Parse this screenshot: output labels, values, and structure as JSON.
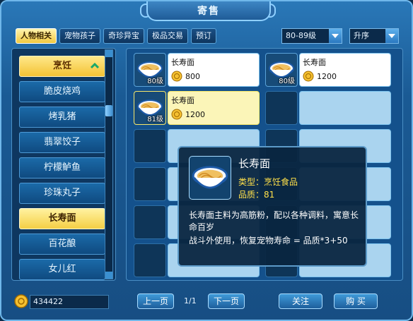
{
  "window": {
    "title": "寄售"
  },
  "tabs": [
    {
      "label": "人物相关",
      "active": true
    },
    {
      "label": "宠物孩子",
      "active": false
    },
    {
      "label": "奇珍异宝",
      "active": false
    },
    {
      "label": "极品交易",
      "active": false
    },
    {
      "label": "预订",
      "active": false
    }
  ],
  "filters": {
    "level": "80-89级",
    "sort": "升序"
  },
  "categories": {
    "header": "烹饪",
    "items": [
      "脆皮烧鸡",
      "烤乳猪",
      "翡翠饺子",
      "柠檬鲈鱼",
      "珍珠丸子",
      "长寿面",
      "百花酿",
      "女儿红"
    ],
    "selected": "长寿面"
  },
  "listings": [
    {
      "name": "长寿面",
      "level": "80级",
      "price": "800"
    },
    {
      "name": "长寿面",
      "level": "80级",
      "price": "1200"
    },
    {
      "name": "长寿面",
      "level": "81级",
      "price": "1200"
    }
  ],
  "tooltip": {
    "name": "长寿面",
    "type": "类型：烹饪食品",
    "quality": "品质：81",
    "desc1": "长寿面主料为高筋粉，配以各种调料，寓意长命百岁",
    "desc2": "战斗外使用，恢复宠物寿命 = 品质*3+50"
  },
  "footer": {
    "money": "434422",
    "prev": "上一页",
    "page": "1/1",
    "next": "下一页",
    "follow": "关注",
    "buy": "购 买"
  },
  "colors": {
    "accent": "#f3c234",
    "panel": "#14518c",
    "tooltip_text": "#ffe04a"
  }
}
